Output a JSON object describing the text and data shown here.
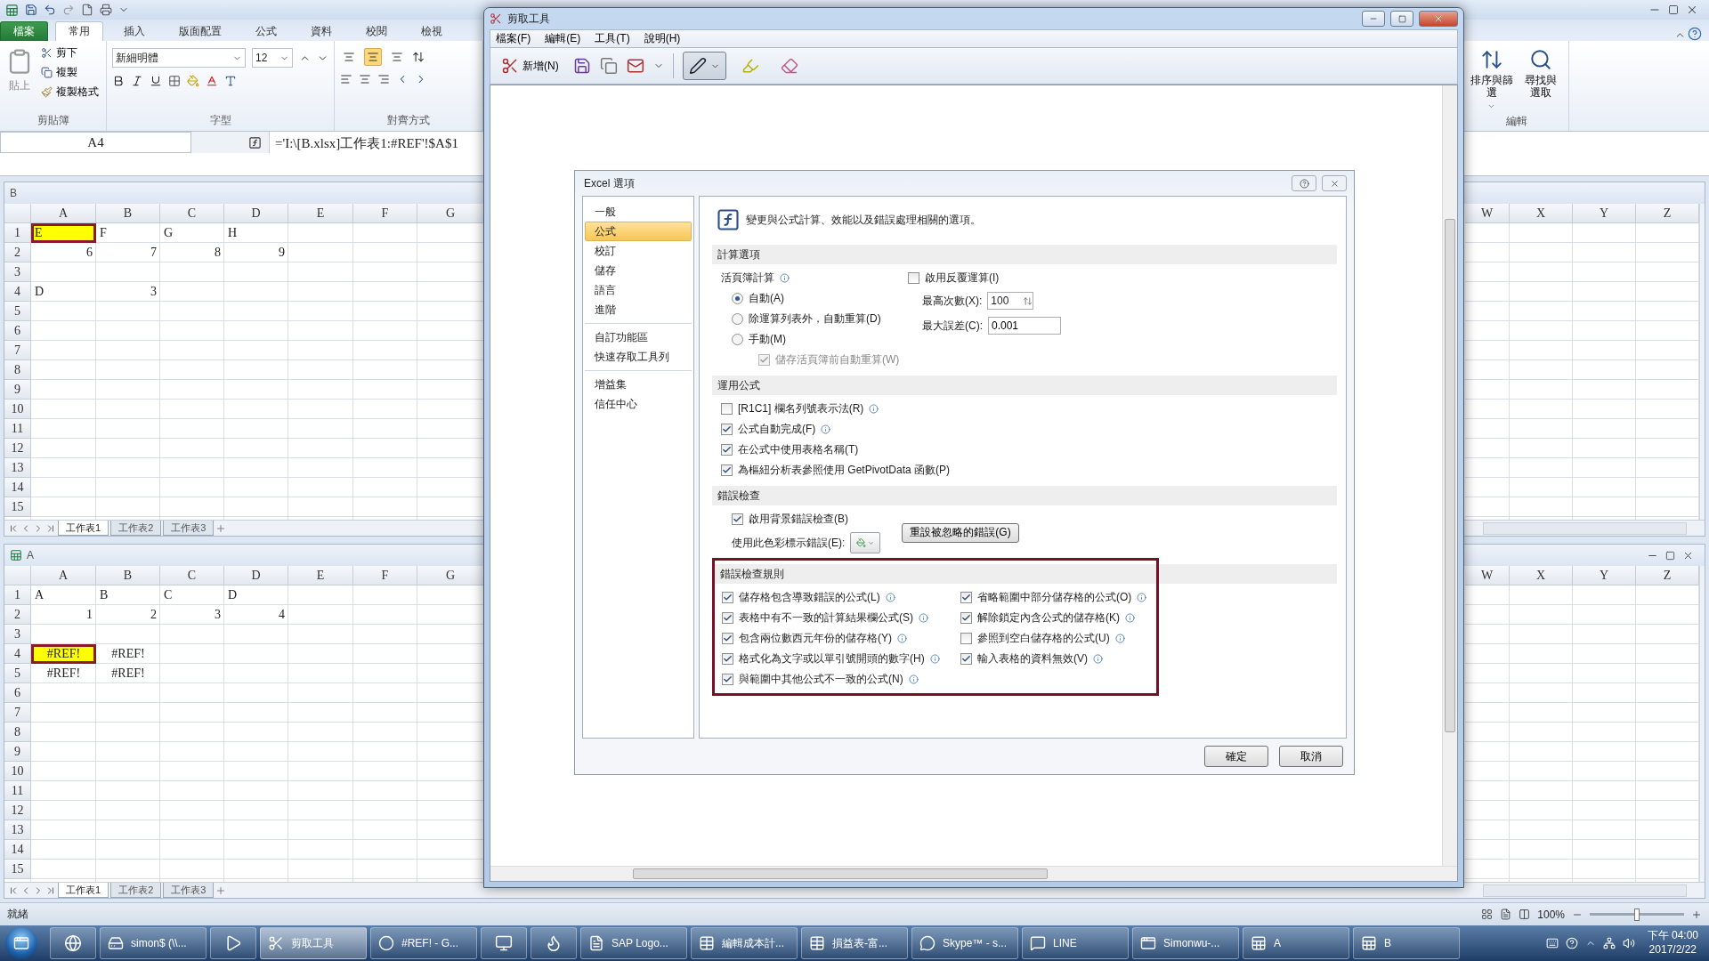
{
  "excel": {
    "ribbon_tabs": [
      {
        "label": "檔案",
        "kind": "file",
        "selected": false
      },
      {
        "label": "常用",
        "kind": "tab",
        "selected": true
      },
      {
        "label": "插入",
        "kind": "tab",
        "selected": false
      },
      {
        "label": "版面配置",
        "kind": "tab",
        "selected": false
      },
      {
        "label": "公式",
        "kind": "tab",
        "selected": false
      },
      {
        "label": "資料",
        "kind": "tab",
        "selected": false
      },
      {
        "label": "校閱",
        "kind": "tab",
        "selected": false
      },
      {
        "label": "檢視",
        "kind": "tab",
        "selected": false
      }
    ],
    "clipboard": {
      "paste": "貼上",
      "cut": "剪下",
      "copy": "複製",
      "format_painter": "複製格式",
      "label": "剪貼簿"
    },
    "font": {
      "name": "新細明體",
      "size": "12",
      "label": "字型"
    },
    "alignment": {
      "vertical": [
        {
          "selected": false
        },
        {
          "selected": true
        },
        {
          "selected": false
        }
      ],
      "label": "對齊方式"
    },
    "editing": {
      "sort": "排序與篩選",
      "find": "尋找與選取",
      "label": "編輯"
    },
    "name_box": "A4",
    "formula": "='I:\\[B.xlsx]工作表1:#REF'!$A$1",
    "workbooks": [
      {
        "title": "B",
        "icon": false,
        "window_buttons": false,
        "columns_left": [
          "A",
          "B",
          "C",
          "D",
          "E",
          "F",
          "G"
        ],
        "columns_right": [
          "W",
          "X",
          "Y",
          "Z"
        ],
        "rows": [
          {
            "number": "1",
            "cells": [
              {
                "text": "E",
                "kind": "text",
                "highlighted": true
              },
              {
                "text": "F",
                "kind": "text",
                "highlighted": false
              },
              {
                "text": "G",
                "kind": "text",
                "highlighted": false
              },
              {
                "text": "H",
                "kind": "text",
                "highlighted": false
              }
            ]
          },
          {
            "number": "2",
            "cells": [
              {
                "text": "6",
                "kind": "number",
                "highlighted": false
              },
              {
                "text": "7",
                "kind": "number",
                "highlighted": false
              },
              {
                "text": "8",
                "kind": "number",
                "highlighted": false
              },
              {
                "text": "9",
                "kind": "number",
                "highlighted": false
              }
            ]
          },
          {
            "number": "3"
          },
          {
            "number": "4",
            "cells": [
              {
                "text": "D",
                "kind": "text",
                "highlighted": false
              },
              {
                "text": "3",
                "kind": "number",
                "highlighted": false
              }
            ]
          },
          {
            "number": "5"
          },
          {
            "number": "6"
          },
          {
            "number": "7"
          },
          {
            "number": "8"
          },
          {
            "number": "9"
          },
          {
            "number": "10"
          },
          {
            "number": "11"
          },
          {
            "number": "12"
          },
          {
            "number": "13"
          },
          {
            "number": "14"
          },
          {
            "number": "15"
          }
        ],
        "sheet_tabs": [
          {
            "label": "工作表1",
            "selected": true
          },
          {
            "label": "工作表2",
            "selected": false
          },
          {
            "label": "工作表3",
            "selected": false
          }
        ]
      },
      {
        "title": "A",
        "icon": true,
        "window_buttons": true,
        "columns_left": [
          "A",
          "B",
          "C",
          "D",
          "E",
          "F",
          "G"
        ],
        "columns_right": [
          "W",
          "X",
          "Y",
          "Z"
        ],
        "rows": [
          {
            "number": "1",
            "cells": [
              {
                "text": "A",
                "kind": "text",
                "highlighted": false
              },
              {
                "text": "B",
                "kind": "text",
                "highlighted": false
              },
              {
                "text": "C",
                "kind": "text",
                "highlighted": false
              },
              {
                "text": "D",
                "kind": "text",
                "highlighted": false
              }
            ]
          },
          {
            "number": "2",
            "cells": [
              {
                "text": "1",
                "kind": "number",
                "highlighted": false
              },
              {
                "text": "2",
                "kind": "number",
                "highlighted": false
              },
              {
                "text": "3",
                "kind": "number",
                "highlighted": false
              },
              {
                "text": "4",
                "kind": "number",
                "highlighted": false
              }
            ]
          },
          {
            "number": "3"
          },
          {
            "number": "4",
            "cells": [
              {
                "text": "#REF!",
                "kind": "error",
                "highlighted": true
              },
              {
                "text": "#REF!",
                "kind": "error",
                "highlighted": false
              }
            ]
          },
          {
            "number": "5",
            "cells": [
              {
                "text": "#REF!",
                "kind": "error",
                "highlighted": false
              },
              {
                "text": "#REF!",
                "kind": "error",
                "highlighted": false
              }
            ]
          },
          {
            "number": "6"
          },
          {
            "number": "7"
          },
          {
            "number": "8"
          },
          {
            "number": "9"
          },
          {
            "number": "10"
          },
          {
            "number": "11"
          },
          {
            "number": "12"
          },
          {
            "number": "13"
          },
          {
            "number": "14"
          },
          {
            "number": "15"
          }
        ],
        "sheet_tabs": [
          {
            "label": "工作表1",
            "selected": true
          },
          {
            "label": "工作表2",
            "selected": false
          },
          {
            "label": "工作表3",
            "selected": false
          }
        ]
      }
    ],
    "status": "就緒",
    "zoom": {
      "reading": "100%",
      "level": 0.5
    }
  },
  "snipping_tool": {
    "title": "剪取工具",
    "menu": [
      "檔案(F)",
      "編輯(E)",
      "工具(T)",
      "說明(H)"
    ],
    "new_button": "新增(N)",
    "tools": [
      {
        "kind": "pen",
        "selected": true
      },
      {
        "kind": "highlighter",
        "selected": false
      },
      {
        "kind": "eraser",
        "selected": false
      }
    ],
    "dialog": {
      "title": "Excel 選項",
      "nav_groups": [
        {
          "items": [
            {
              "label": "一般",
              "selected": false
            },
            {
              "label": "公式",
              "selected": true
            },
            {
              "label": "校訂",
              "selected": false
            },
            {
              "label": "儲存",
              "selected": false
            },
            {
              "label": "語言",
              "selected": false
            },
            {
              "label": "進階",
              "selected": false
            }
          ]
        },
        {
          "items": [
            {
              "label": "自訂功能區",
              "selected": false
            },
            {
              "label": "快速存取工具列",
              "selected": false
            }
          ]
        },
        {
          "items": [
            {
              "label": "增益集",
              "selected": false
            },
            {
              "label": "信任中心",
              "selected": false
            }
          ]
        }
      ],
      "header": "變更與公式計算、效能以及錯誤處理相關的選項。",
      "calculation": {
        "heading": "計算選項",
        "workbook_label": "活頁簿計算",
        "modes": [
          {
            "label": "自動(A)",
            "selected": true
          },
          {
            "label": "除運算列表外，自動重算(D)",
            "selected": false
          },
          {
            "label": "手動(M)",
            "selected": false
          }
        ],
        "save_recalc": {
          "label": "儲存活頁簿前自動重算(W)",
          "checked": true,
          "disabled": true
        },
        "iterative": {
          "label": "啟用反覆運算(I)",
          "checked": false
        },
        "max_iterations": {
          "label": "最高次數(X):",
          "value": "100"
        },
        "max_change": {
          "label": "最大誤差(C):",
          "value": "0.001"
        }
      },
      "formulas": {
        "heading": "運用公式",
        "options": [
          {
            "label": "[R1C1] 欄名列號表示法(R)",
            "checked": false,
            "info": true
          },
          {
            "label": "公式自動完成(F)",
            "checked": true,
            "info": true
          },
          {
            "label": "在公式中使用表格名稱(T)",
            "checked": true,
            "info": false
          },
          {
            "label": "為樞紐分析表參照使用 GetPivotData 函數(P)",
            "checked": true,
            "info": false
          }
        ]
      },
      "error_checking": {
        "heading": "錯誤檢查",
        "background": {
          "label": "啟用背景錯誤檢查(B)",
          "checked": true
        },
        "color_label": "使用此色彩標示錯誤(E):",
        "reset_button": "重設被忽略的錯誤(G)"
      },
      "rules": {
        "heading": "錯誤檢查規則",
        "highlighted": true,
        "left": [
          {
            "label": "儲存格包含導致錯誤的公式(L)",
            "checked": true,
            "info": true
          },
          {
            "label": "表格中有不一致的計算結果欄公式(S)",
            "checked": true,
            "info": true
          },
          {
            "label": "包含兩位數西元年份的儲存格(Y)",
            "checked": true,
            "info": true
          },
          {
            "label": "格式化為文字或以單引號開頭的數字(H)",
            "checked": true,
            "info": true
          },
          {
            "label": "與範圍中其他公式不一致的公式(N)",
            "checked": true,
            "info": true
          }
        ],
        "right": [
          {
            "label": "省略範圍中部分儲存格的公式(O)",
            "checked": true,
            "info": true
          },
          {
            "label": "解除鎖定內含公式的儲存格(K)",
            "checked": true,
            "info": true
          },
          {
            "label": "參照到空白儲存格的公式(U)",
            "checked": false,
            "info": true
          },
          {
            "label": "輸入表格的資料無效(V)",
            "checked": true,
            "info": true
          }
        ]
      },
      "buttons": [
        "確定",
        "取消"
      ]
    }
  },
  "taskbar": {
    "items": [
      {
        "kind": "globe",
        "selected": false
      },
      {
        "kind": "drive",
        "label": "simon$ (\\\\...",
        "selected": false
      },
      {
        "kind": "play",
        "selected": false
      },
      {
        "kind": "scissors",
        "label": "剪取工具",
        "selected": true
      },
      {
        "kind": "circle",
        "label": "#REF! - G...",
        "selected": false
      },
      {
        "kind": "monitor",
        "selected": false
      },
      {
        "kind": "flame",
        "selected": false
      },
      {
        "kind": "document",
        "label": "SAP Logo...",
        "selected": false
      },
      {
        "kind": "table",
        "label": "編輯成本計...",
        "selected": false
      },
      {
        "kind": "table",
        "label": "損益表-富...",
        "selected": false
      },
      {
        "kind": "chat",
        "label": "Skype™ - s...",
        "selected": false
      },
      {
        "kind": "message",
        "label": "LINE",
        "selected": false
      },
      {
        "kind": "window",
        "label": "Simonwu-...",
        "selected": false
      },
      {
        "kind": "sheet",
        "label": "A",
        "selected": false
      },
      {
        "kind": "sheet",
        "label": "B",
        "selected": false
      }
    ],
    "time": "下午 04:00",
    "date": "2017/2/22"
  }
}
